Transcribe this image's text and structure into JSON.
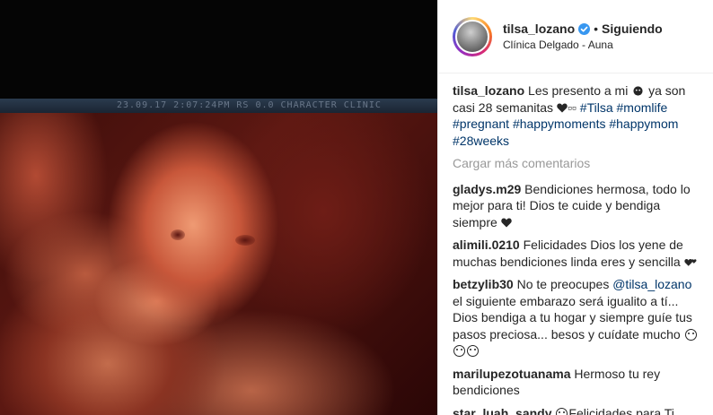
{
  "header": {
    "username": "tilsa_lozano",
    "separator": "•",
    "follow_status": "Siguiendo",
    "location": "Clínica Delgado - Auna"
  },
  "media": {
    "overlay_text": "23.09.17  2:07:24PM     RS 0.0    CHARACTER CLINIC"
  },
  "caption": {
    "username": "tilsa_lozano",
    "text_1": " Les presento a mi ",
    "text_2": " ya son casi 28 semanitas ",
    "text_3": "▫▫ ",
    "hashtags": [
      "#Tilsa",
      "#momlife",
      "#pregnant",
      "#happymoments",
      "#happymom",
      "#28weeks"
    ]
  },
  "load_more_label": "Cargar más comentarios",
  "comments": [
    {
      "username": "gladys.m29",
      "text": " Bendiciones hermosa, todo lo mejor para ti! Dios te cuide y bendiga siempre "
    },
    {
      "username": "alimili.0210",
      "text": " Felicidades Dios los yene de muchas bendiciones linda eres y sencilla "
    },
    {
      "username": "betzylib30",
      "text_1": " No te preocupes ",
      "mention": "@tilsa_lozano",
      "text_2": " el siguiente embarazo será igualito a tí... Dios bendiga a tu hogar y siempre guíe tus pasos preciosa... besos y cuídate mucho "
    },
    {
      "username": "marilupezotuanama",
      "text": " Hermoso tu rey bendiciones"
    },
    {
      "username": "star_luah_sandy",
      "text": "Felicidades para Ti"
    }
  ],
  "colors": {
    "verified": "#3897f0",
    "link": "#003569",
    "muted": "#999999",
    "text": "#262626"
  }
}
